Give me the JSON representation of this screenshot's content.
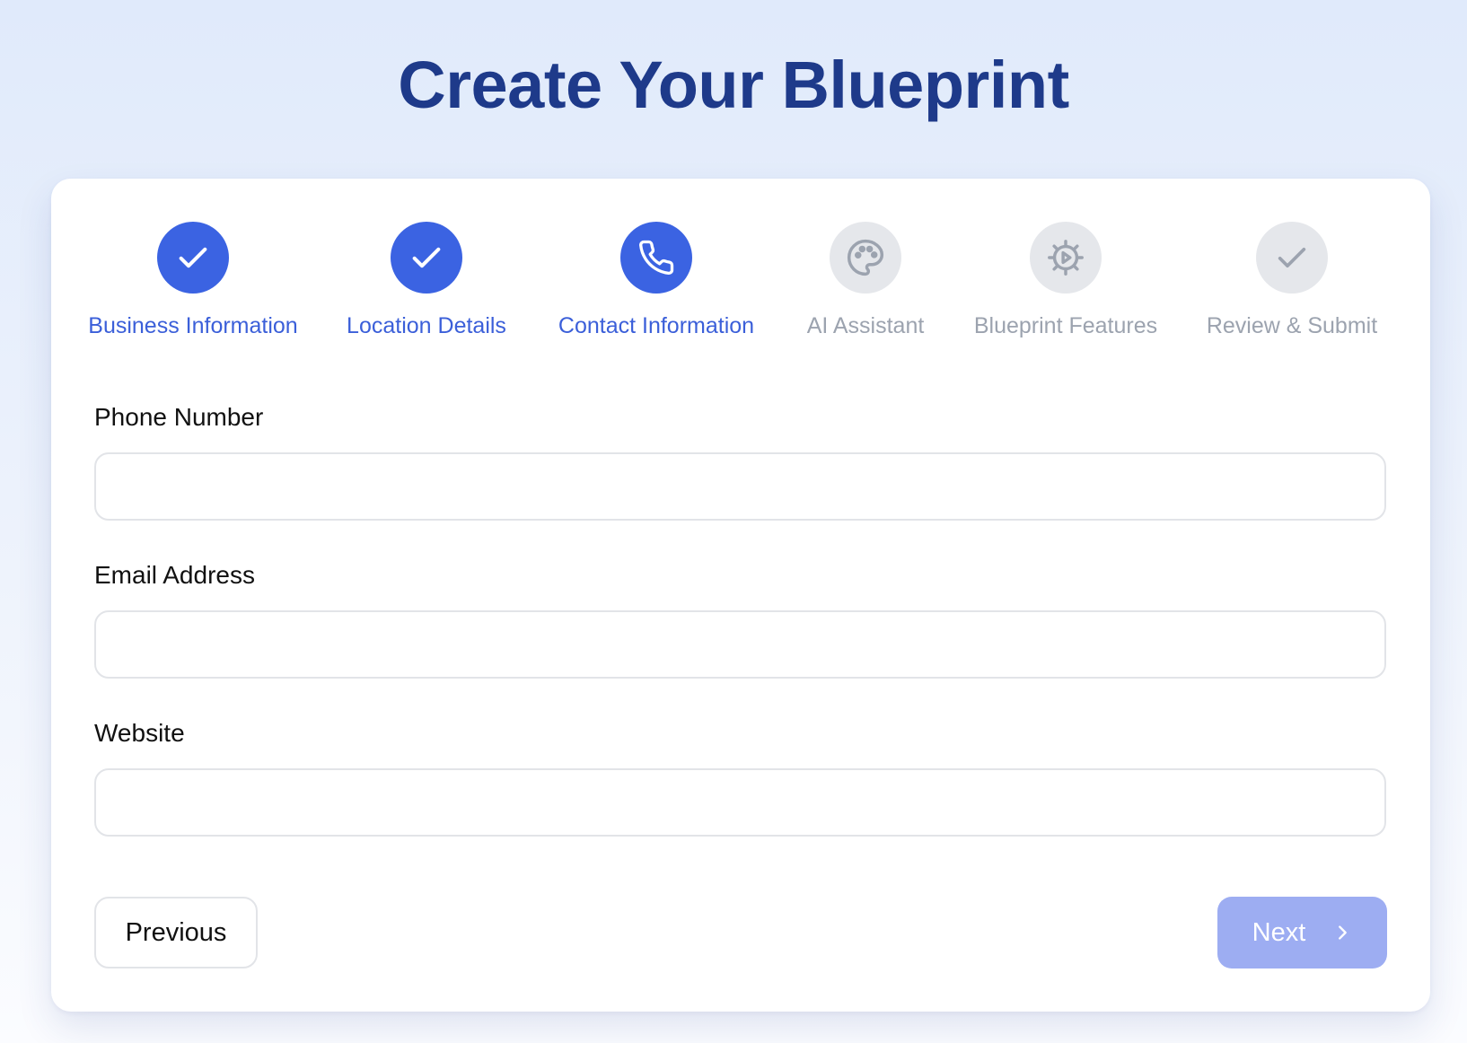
{
  "page": {
    "title": "Create Your Blueprint"
  },
  "colors": {
    "accent": "#3b63e2",
    "title": "#1e3a8a",
    "pending": "#e5e7eb",
    "pending_text": "#9ca3af",
    "next_button": "#9dadf2"
  },
  "stepper": {
    "steps": [
      {
        "label": "Business Information",
        "state": "completed",
        "icon": "check-icon"
      },
      {
        "label": "Location Details",
        "state": "completed",
        "icon": "check-icon"
      },
      {
        "label": "Contact Information",
        "state": "current",
        "icon": "phone-icon"
      },
      {
        "label": "AI Assistant",
        "state": "pending",
        "icon": "palette-icon"
      },
      {
        "label": "Blueprint Features",
        "state": "pending",
        "icon": "gear-icon"
      },
      {
        "label": "Review & Submit",
        "state": "pending",
        "icon": "check-icon"
      }
    ]
  },
  "form": {
    "phone": {
      "label": "Phone Number",
      "value": "",
      "placeholder": ""
    },
    "email": {
      "label": "Email Address",
      "value": "",
      "placeholder": ""
    },
    "website": {
      "label": "Website",
      "value": "",
      "placeholder": ""
    }
  },
  "actions": {
    "previous_label": "Previous",
    "next_label": "Next"
  }
}
